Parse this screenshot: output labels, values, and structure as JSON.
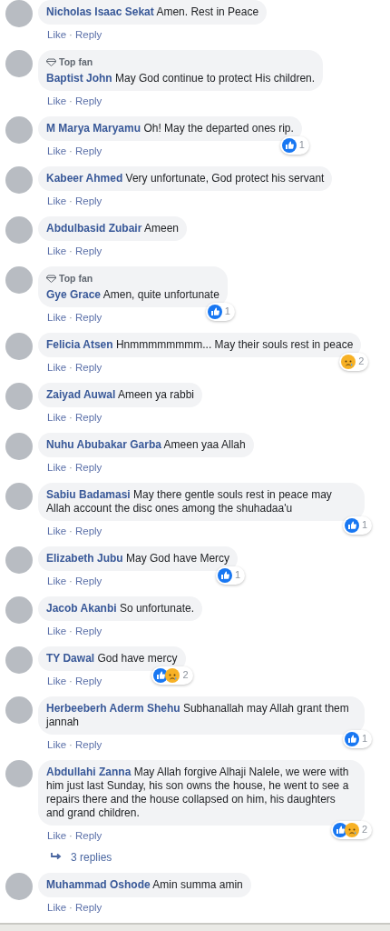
{
  "comments": [
    {
      "name": "Nicholas Isaac Sekat",
      "text": "Amen. Rest in Peace",
      "actions": [
        "Like",
        "·",
        "Reply"
      ]
    },
    {
      "name": "Baptist John",
      "text": "May God continue to protect His children.",
      "badge": "Top fan",
      "actions": [
        "Like",
        "·",
        "Reply"
      ]
    },
    {
      "name": "M Marya Maryamu",
      "text": "Oh! May the departed ones rip.",
      "actions": [
        "Like",
        "·",
        "Reply"
      ],
      "reactions": [
        {
          "kind": "like"
        }
      ],
      "reaction_count": "1"
    },
    {
      "name": "Kabeer Ahmed",
      "text": "Very unfortunate, God protect his servant",
      "actions": [
        "Like",
        "·",
        "Reply"
      ]
    },
    {
      "name": "Abdulbasid Zubair",
      "text": "Ameen",
      "actions": [
        "Like",
        "·",
        "Reply"
      ]
    },
    {
      "name": "Gye Grace",
      "text": "Amen, quite unfortunate",
      "badge": "Top fan",
      "actions": [
        "Like",
        "·",
        "Reply"
      ],
      "reactions": [
        {
          "kind": "like"
        }
      ],
      "reaction_count": "1"
    },
    {
      "name": "Felicia Atsen",
      "text": "Hnmmmmmmmm... May their souls rest in peace",
      "actions": [
        "Like",
        "·",
        "Reply"
      ],
      "reactions": [
        {
          "kind": "sad"
        }
      ],
      "reaction_count": "2"
    },
    {
      "name": "Zaiyad Auwal",
      "text": "Ameen ya rabbi",
      "actions": [
        "Like",
        "·",
        "Reply"
      ]
    },
    {
      "name": "Nuhu Abubakar Garba",
      "text": "Ameen yaa Allah",
      "actions": [
        "Like",
        "·",
        "Reply"
      ]
    },
    {
      "name": "Sabiu Badamasi",
      "text": "May there gentle souls rest in peace may Allah account the disc ones among the shuhadaa'u",
      "actions": [
        "Like",
        "·",
        "Reply"
      ],
      "reactions": [
        {
          "kind": "like"
        }
      ],
      "reaction_count": "1"
    },
    {
      "name": "Elizabeth Jubu",
      "text": "May God have Mercy",
      "actions": [
        "Like",
        "·",
        "Reply"
      ],
      "reactions": [
        {
          "kind": "like"
        }
      ],
      "reaction_count": "1"
    },
    {
      "name": "Jacob Akanbi",
      "text": "So unfortunate.",
      "actions": [
        "Like",
        "·",
        "Reply"
      ]
    },
    {
      "name": "TY Dawal",
      "text": "God have mercy",
      "actions": [
        "Like",
        "·",
        "Reply"
      ],
      "reactions": [
        {
          "kind": "like"
        },
        {
          "kind": "sad"
        }
      ],
      "reaction_count": "2"
    },
    {
      "name": "Herbeeberh Aderm Shehu",
      "text": "Subhanallah may Allah grant them jannah",
      "actions": [
        "Like",
        "·",
        "Reply"
      ],
      "reactions": [
        {
          "kind": "like"
        }
      ],
      "reaction_count": "1"
    },
    {
      "name": "Abdullahi Zanna",
      "text": "May Allah forgive Alhaji Nalele, we were with him just last Sunday, his son owns the house, he went to see a repairs there and the house collapsed on him, his daughters and grand children.",
      "actions": [
        "Like",
        "·",
        "Reply"
      ],
      "reactions": [
        {
          "kind": "like"
        },
        {
          "kind": "sad"
        }
      ],
      "reaction_count": "2",
      "replies": "3 replies"
    },
    {
      "name": "Muhammad Oshode",
      "text": "Amin summa amin",
      "actions": [
        "Like",
        "·",
        "Reply"
      ]
    }
  ]
}
